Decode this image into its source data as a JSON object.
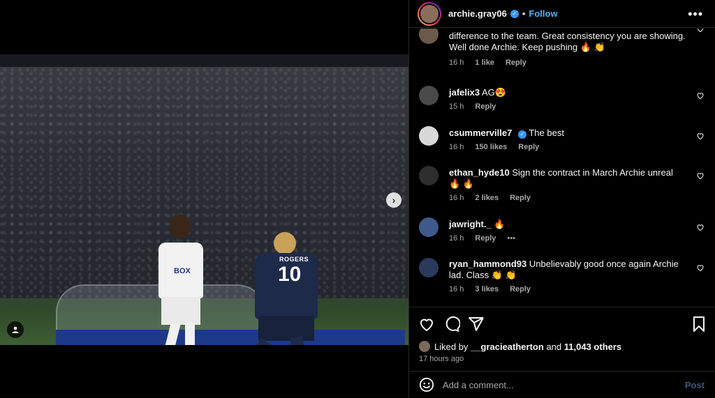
{
  "header": {
    "username": "archie.gray06",
    "separator": "•",
    "follow_label": "Follow",
    "more_label": "•••"
  },
  "media": {
    "player_name_back": "ROGERS",
    "player_number": "10",
    "shirt_sponsor": "BOX"
  },
  "comments": [
    {
      "text": "difference to the team. Great consistency you are showing. Well done Archie. Keep pushing 🔥 👏",
      "time": "16 h",
      "likes": "1 like",
      "reply": "Reply"
    },
    {
      "username": "jafelix3",
      "text": "AG😍",
      "time": "15 h",
      "reply": "Reply"
    },
    {
      "username": "csummerville7",
      "verified": true,
      "text": "The best",
      "time": "16 h",
      "likes": "150 likes",
      "reply": "Reply"
    },
    {
      "username": "ethan_hyde10",
      "text": "Sign the contract in March Archie unreal 🔥 🔥",
      "time": "16 h",
      "likes": "2 likes",
      "reply": "Reply"
    },
    {
      "username": "jawright._",
      "text": "🔥",
      "time": "16 h",
      "reply": "Reply",
      "more": "•••"
    },
    {
      "username": "ryan_hammond93",
      "text": "Unbelievably good once again Archie lad. Class 👏 👏",
      "time": "16 h",
      "likes": "3 likes",
      "reply": "Reply"
    }
  ],
  "footer": {
    "liked_prefix": "Liked by",
    "liked_user": "__gracieatherton",
    "liked_and": "and",
    "liked_count": "11,043 others",
    "posted_ago": "17 hours ago",
    "comment_placeholder": "Add a comment...",
    "post_label": "Post"
  },
  "icons": [
    "heart-icon",
    "comment-icon",
    "share-icon",
    "bookmark-icon",
    "emoji-icon",
    "chevron-right-icon",
    "user-tag-icon",
    "verified-icon"
  ],
  "colors": {
    "accent": "#4cb5f9",
    "verified": "#3897f0",
    "muted": "#a8a8a8",
    "post_disabled": "#3e5a7e"
  }
}
